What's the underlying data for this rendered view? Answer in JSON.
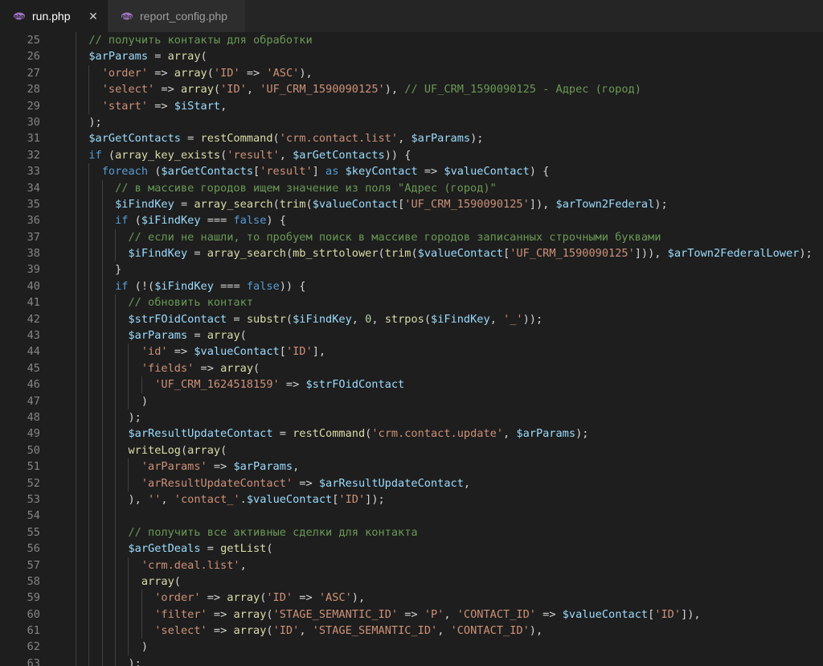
{
  "tabs": [
    {
      "label": "run.php",
      "active": true,
      "close": "✕"
    },
    {
      "label": "report_config.php",
      "active": false
    }
  ],
  "colors": {
    "comment": "#6a9955",
    "variable": "#9cdcfe",
    "keyword": "#569cd6",
    "string": "#ce9178",
    "function": "#dcdcaa",
    "number": "#b5cea8",
    "plain": "#d4d4d4"
  },
  "lines": [
    {
      "n": "25",
      "indent": 1,
      "t": [
        [
          "c",
          "// получить контакты для обработки"
        ]
      ]
    },
    {
      "n": "26",
      "indent": 1,
      "t": [
        [
          "v",
          "$arParams"
        ],
        [
          "p",
          " = "
        ],
        [
          "f",
          "array"
        ],
        [
          "p",
          "("
        ]
      ]
    },
    {
      "n": "27",
      "indent": 2,
      "t": [
        [
          "s",
          "'order'"
        ],
        [
          "p",
          " => "
        ],
        [
          "f",
          "array"
        ],
        [
          "p",
          "("
        ],
        [
          "s",
          "'ID'"
        ],
        [
          "p",
          " => "
        ],
        [
          "s",
          "'ASC'"
        ],
        [
          "p",
          "),"
        ]
      ]
    },
    {
      "n": "28",
      "indent": 2,
      "t": [
        [
          "s",
          "'select'"
        ],
        [
          "p",
          " => "
        ],
        [
          "f",
          "array"
        ],
        [
          "p",
          "("
        ],
        [
          "s",
          "'ID'"
        ],
        [
          "p",
          ", "
        ],
        [
          "s",
          "'UF_CRM_1590090125'"
        ],
        [
          "p",
          "), "
        ],
        [
          "c",
          "// UF_CRM_1590090125 - Адрес (город)"
        ]
      ]
    },
    {
      "n": "29",
      "indent": 2,
      "t": [
        [
          "s",
          "'start'"
        ],
        [
          "p",
          " => "
        ],
        [
          "v",
          "$iStart"
        ],
        [
          "p",
          ","
        ]
      ]
    },
    {
      "n": "30",
      "indent": 1,
      "t": [
        [
          "p",
          ");"
        ]
      ]
    },
    {
      "n": "31",
      "indent": 1,
      "t": [
        [
          "v",
          "$arGetContacts"
        ],
        [
          "p",
          " = "
        ],
        [
          "f",
          "restCommand"
        ],
        [
          "p",
          "("
        ],
        [
          "s",
          "'crm.contact.list'"
        ],
        [
          "p",
          ", "
        ],
        [
          "v",
          "$arParams"
        ],
        [
          "p",
          ");"
        ]
      ]
    },
    {
      "n": "32",
      "indent": 1,
      "t": [
        [
          "k",
          "if"
        ],
        [
          "p",
          " ("
        ],
        [
          "f",
          "array_key_exists"
        ],
        [
          "p",
          "("
        ],
        [
          "s",
          "'result'"
        ],
        [
          "p",
          ", "
        ],
        [
          "v",
          "$arGetContacts"
        ],
        [
          "p",
          ")) {"
        ]
      ]
    },
    {
      "n": "33",
      "indent": 2,
      "t": [
        [
          "k",
          "foreach"
        ],
        [
          "p",
          " ("
        ],
        [
          "v",
          "$arGetContacts"
        ],
        [
          "p",
          "["
        ],
        [
          "s",
          "'result'"
        ],
        [
          "p",
          "] "
        ],
        [
          "k",
          "as"
        ],
        [
          "p",
          " "
        ],
        [
          "v",
          "$keyContact"
        ],
        [
          "p",
          " => "
        ],
        [
          "v",
          "$valueContact"
        ],
        [
          "p",
          ") {"
        ]
      ]
    },
    {
      "n": "34",
      "indent": 3,
      "t": [
        [
          "c",
          "// в массиве городов ищем значение из поля \"Адрес (город)\""
        ]
      ]
    },
    {
      "n": "35",
      "indent": 3,
      "t": [
        [
          "v",
          "$iFindKey"
        ],
        [
          "p",
          " = "
        ],
        [
          "f",
          "array_search"
        ],
        [
          "p",
          "("
        ],
        [
          "f",
          "trim"
        ],
        [
          "p",
          "("
        ],
        [
          "v",
          "$valueContact"
        ],
        [
          "p",
          "["
        ],
        [
          "s",
          "'UF_CRM_1590090125'"
        ],
        [
          "p",
          "]), "
        ],
        [
          "v",
          "$arTown2Federal"
        ],
        [
          "p",
          ");"
        ]
      ]
    },
    {
      "n": "36",
      "indent": 3,
      "t": [
        [
          "k",
          "if"
        ],
        [
          "p",
          " ("
        ],
        [
          "v",
          "$iFindKey"
        ],
        [
          "p",
          " === "
        ],
        [
          "k",
          "false"
        ],
        [
          "p",
          ") {"
        ]
      ]
    },
    {
      "n": "37",
      "indent": 4,
      "t": [
        [
          "c",
          "// если не нашли, то пробуем поиск в массиве городов записанных строчными буквами"
        ]
      ]
    },
    {
      "n": "38",
      "indent": 4,
      "t": [
        [
          "v",
          "$iFindKey"
        ],
        [
          "p",
          " = "
        ],
        [
          "f",
          "array_search"
        ],
        [
          "p",
          "("
        ],
        [
          "f",
          "mb_strtolower"
        ],
        [
          "p",
          "("
        ],
        [
          "f",
          "trim"
        ],
        [
          "p",
          "("
        ],
        [
          "v",
          "$valueContact"
        ],
        [
          "p",
          "["
        ],
        [
          "s",
          "'UF_CRM_1590090125'"
        ],
        [
          "p",
          "])), "
        ],
        [
          "v",
          "$arTown2FederalLower"
        ],
        [
          "p",
          ");"
        ]
      ]
    },
    {
      "n": "39",
      "indent": 3,
      "t": [
        [
          "p",
          "}"
        ]
      ]
    },
    {
      "n": "40",
      "indent": 3,
      "t": [
        [
          "k",
          "if"
        ],
        [
          "p",
          " (!("
        ],
        [
          "v",
          "$iFindKey"
        ],
        [
          "p",
          " === "
        ],
        [
          "k",
          "false"
        ],
        [
          "p",
          ")) {"
        ]
      ]
    },
    {
      "n": "41",
      "indent": 4,
      "t": [
        [
          "c",
          "// обновить контакт"
        ]
      ]
    },
    {
      "n": "42",
      "indent": 4,
      "t": [
        [
          "v",
          "$strFOidContact"
        ],
        [
          "p",
          " = "
        ],
        [
          "f",
          "substr"
        ],
        [
          "p",
          "("
        ],
        [
          "v",
          "$iFindKey"
        ],
        [
          "p",
          ", "
        ],
        [
          "n",
          "0"
        ],
        [
          "p",
          ", "
        ],
        [
          "f",
          "strpos"
        ],
        [
          "p",
          "("
        ],
        [
          "v",
          "$iFindKey"
        ],
        [
          "p",
          ", "
        ],
        [
          "s",
          "'_'"
        ],
        [
          "p",
          "));"
        ]
      ]
    },
    {
      "n": "43",
      "indent": 4,
      "t": [
        [
          "v",
          "$arParams"
        ],
        [
          "p",
          " = "
        ],
        [
          "f",
          "array"
        ],
        [
          "p",
          "("
        ]
      ]
    },
    {
      "n": "44",
      "indent": 5,
      "t": [
        [
          "s",
          "'id'"
        ],
        [
          "p",
          " => "
        ],
        [
          "v",
          "$valueContact"
        ],
        [
          "p",
          "["
        ],
        [
          "s",
          "'ID'"
        ],
        [
          "p",
          "],"
        ]
      ]
    },
    {
      "n": "45",
      "indent": 5,
      "t": [
        [
          "s",
          "'fields'"
        ],
        [
          "p",
          " => "
        ],
        [
          "f",
          "array"
        ],
        [
          "p",
          "("
        ]
      ]
    },
    {
      "n": "46",
      "indent": 6,
      "t": [
        [
          "s",
          "'UF_CRM_1624518159'"
        ],
        [
          "p",
          " => "
        ],
        [
          "v",
          "$strFOidContact"
        ]
      ]
    },
    {
      "n": "47",
      "indent": 5,
      "t": [
        [
          "p",
          ")"
        ]
      ]
    },
    {
      "n": "48",
      "indent": 4,
      "t": [
        [
          "p",
          ");"
        ]
      ]
    },
    {
      "n": "49",
      "indent": 4,
      "t": [
        [
          "v",
          "$arResultUpdateContact"
        ],
        [
          "p",
          " = "
        ],
        [
          "f",
          "restCommand"
        ],
        [
          "p",
          "("
        ],
        [
          "s",
          "'crm.contact.update'"
        ],
        [
          "p",
          ", "
        ],
        [
          "v",
          "$arParams"
        ],
        [
          "p",
          ");"
        ]
      ]
    },
    {
      "n": "50",
      "indent": 4,
      "t": [
        [
          "f",
          "writeLog"
        ],
        [
          "p",
          "("
        ],
        [
          "f",
          "array"
        ],
        [
          "p",
          "("
        ]
      ]
    },
    {
      "n": "51",
      "indent": 5,
      "t": [
        [
          "s",
          "'arParams'"
        ],
        [
          "p",
          " => "
        ],
        [
          "v",
          "$arParams"
        ],
        [
          "p",
          ","
        ]
      ]
    },
    {
      "n": "52",
      "indent": 5,
      "t": [
        [
          "s",
          "'arResultUpdateContact'"
        ],
        [
          "p",
          " => "
        ],
        [
          "v",
          "$arResultUpdateContact"
        ],
        [
          "p",
          ","
        ]
      ]
    },
    {
      "n": "53",
      "indent": 4,
      "t": [
        [
          "p",
          "), "
        ],
        [
          "s",
          "''"
        ],
        [
          "p",
          ", "
        ],
        [
          "s",
          "'contact_'"
        ],
        [
          "p",
          "."
        ],
        [
          "v",
          "$valueContact"
        ],
        [
          "p",
          "["
        ],
        [
          "s",
          "'ID'"
        ],
        [
          "p",
          "]);"
        ]
      ]
    },
    {
      "n": "54",
      "indent": 4,
      "t": []
    },
    {
      "n": "55",
      "indent": 4,
      "t": [
        [
          "c",
          "// получить все активные сделки для контакта"
        ]
      ]
    },
    {
      "n": "56",
      "indent": 4,
      "t": [
        [
          "v",
          "$arGetDeals"
        ],
        [
          "p",
          " = "
        ],
        [
          "f",
          "getList"
        ],
        [
          "p",
          "("
        ]
      ]
    },
    {
      "n": "57",
      "indent": 5,
      "t": [
        [
          "s",
          "'crm.deal.list'"
        ],
        [
          "p",
          ","
        ]
      ]
    },
    {
      "n": "58",
      "indent": 5,
      "t": [
        [
          "f",
          "array"
        ],
        [
          "p",
          "("
        ]
      ]
    },
    {
      "n": "59",
      "indent": 6,
      "t": [
        [
          "s",
          "'order'"
        ],
        [
          "p",
          " => "
        ],
        [
          "f",
          "array"
        ],
        [
          "p",
          "("
        ],
        [
          "s",
          "'ID'"
        ],
        [
          "p",
          " => "
        ],
        [
          "s",
          "'ASC'"
        ],
        [
          "p",
          "),"
        ]
      ]
    },
    {
      "n": "60",
      "indent": 6,
      "t": [
        [
          "s",
          "'filter'"
        ],
        [
          "p",
          " => "
        ],
        [
          "f",
          "array"
        ],
        [
          "p",
          "("
        ],
        [
          "s",
          "'STAGE_SEMANTIC_ID'"
        ],
        [
          "p",
          " => "
        ],
        [
          "s",
          "'P'"
        ],
        [
          "p",
          ", "
        ],
        [
          "s",
          "'CONTACT_ID'"
        ],
        [
          "p",
          " => "
        ],
        [
          "v",
          "$valueContact"
        ],
        [
          "p",
          "["
        ],
        [
          "s",
          "'ID'"
        ],
        [
          "p",
          "]),"
        ]
      ]
    },
    {
      "n": "61",
      "indent": 6,
      "t": [
        [
          "s",
          "'select'"
        ],
        [
          "p",
          " => "
        ],
        [
          "f",
          "array"
        ],
        [
          "p",
          "("
        ],
        [
          "s",
          "'ID'"
        ],
        [
          "p",
          ", "
        ],
        [
          "s",
          "'STAGE_SEMANTIC_ID'"
        ],
        [
          "p",
          ", "
        ],
        [
          "s",
          "'CONTACT_ID'"
        ],
        [
          "p",
          "),"
        ]
      ]
    },
    {
      "n": "62",
      "indent": 5,
      "t": [
        [
          "p",
          ")"
        ]
      ]
    },
    {
      "n": "63",
      "indent": 4,
      "t": [
        [
          "p",
          ");"
        ]
      ]
    }
  ]
}
